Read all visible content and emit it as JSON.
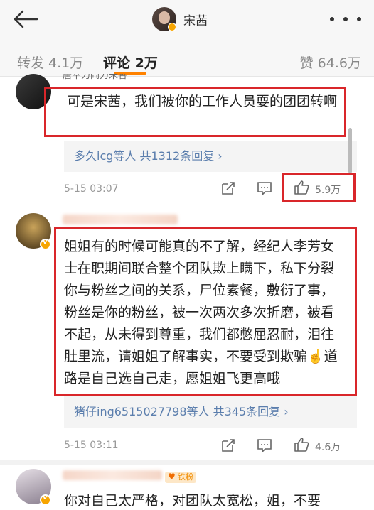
{
  "header": {
    "title": "宋茜",
    "back_icon": "arrow-left-icon",
    "more_icon": "more-dots-icon"
  },
  "tabs": {
    "repost": "转发 4.1万",
    "comments": "评论 2万",
    "likes": "赞 64.6万",
    "accent_color": "#ff8200"
  },
  "comments": [
    {
      "username": "唐幸力闹力米香",
      "text": "可是宋茜，我们被你的工作人员耍的团团转啊",
      "replies_prefix": "多久icg等人 ",
      "replies_count": "共1312条回复 ›",
      "date": "5-15 03:07",
      "likes": "5.9万"
    },
    {
      "text": "姐姐有的时候可能真的不了解，经纪人李芳女士在职期间联合整个团队欺上瞒下，私下分裂你与粉丝之间的关系，尸位素餐，敷衍了事，粉丝是你的粉丝，被一次两次多次折磨，被看不起，从未得到尊重，我们都憋屈忍耐，泪往肚里流，请姐姐了解事实，不要受到欺骗☝️道路是自己选自己走，愿姐姐飞更高哦",
      "replies_prefix": "猪仔ing6515027798等人 ",
      "replies_count": "共345条回复 ›",
      "date": "5-15 03:11",
      "likes": "4.6万"
    },
    {
      "badge": "铁粉",
      "text": "你对自己太严格，对团队太宽松，姐，不要"
    }
  ],
  "colors": {
    "highlight_box": "#d9262a",
    "username": "#eb7350",
    "link": "#5b7ead"
  }
}
